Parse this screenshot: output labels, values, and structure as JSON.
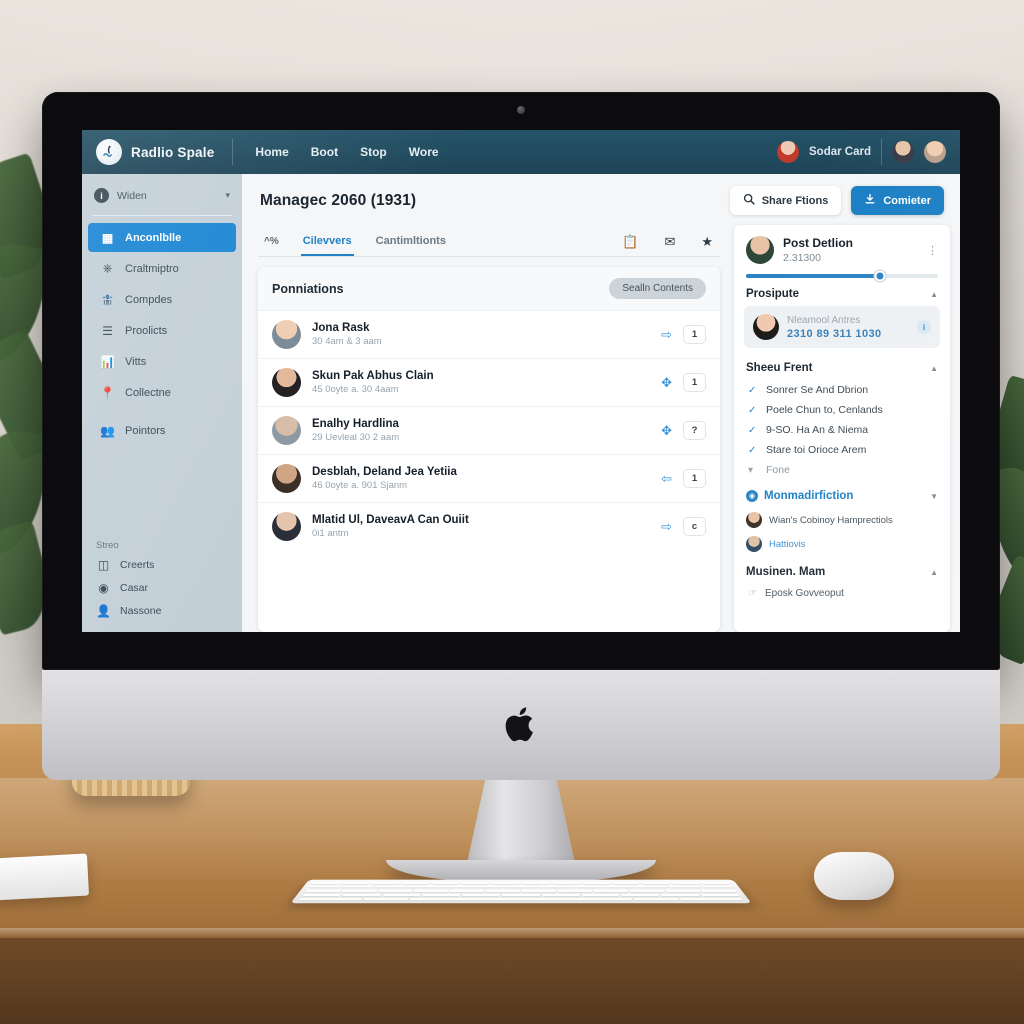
{
  "topnav": {
    "brand_name": "Radlio Spale",
    "brand_logo_icon": "wave-logo-icon",
    "links": [
      {
        "label": "Home"
      },
      {
        "label": "Boot"
      },
      {
        "label": "Stop"
      },
      {
        "label": "Wore"
      }
    ],
    "user_label": "Sodar Card",
    "avatars": [
      "avatar-red",
      "avatar-dark",
      "avatar-tan"
    ]
  },
  "sidebar": {
    "widen": {
      "label": "Widen",
      "badge": "i",
      "caret_icon": "chevron-down-icon"
    },
    "items": [
      {
        "label": "Anconlblle",
        "icon": "grid-icon",
        "active": true
      },
      {
        "label": "Craltmiptro",
        "icon": "clock-icon",
        "active": false
      },
      {
        "label": "Compdes",
        "icon": "bank-icon",
        "active": false
      },
      {
        "label": "Proolicts",
        "icon": "list-icon",
        "active": false
      },
      {
        "label": "Vitts",
        "icon": "chart-icon",
        "active": false
      },
      {
        "label": "Collectne",
        "icon": "pin-icon",
        "active": false
      },
      {
        "label": "Pointors",
        "icon": "people-icon",
        "active": false
      }
    ],
    "footer_title": "Streo",
    "footer_items": [
      {
        "label": "Creerts",
        "icon": "door-icon"
      },
      {
        "label": "Casar",
        "icon": "camera-icon"
      },
      {
        "label": "Nassone",
        "icon": "person-icon"
      }
    ]
  },
  "main": {
    "page_title": "Managec 2060 (1931)",
    "share_button": {
      "label": "Share Ftions",
      "icon": "search-icon"
    },
    "primary_button": {
      "label": "Comieter",
      "icon": "download-icon"
    },
    "tabs": [
      {
        "label": "^%",
        "active": false,
        "mini": true
      },
      {
        "label": "Cilevvers",
        "active": true,
        "mini": false
      },
      {
        "label": "Cantimltionts",
        "active": false,
        "mini": false
      }
    ],
    "tab_icons": [
      "note-edit-icon",
      "mail-icon",
      "star-icon"
    ],
    "card": {
      "title": "Ponniations",
      "pill_label": "Sealln Contents",
      "rows": [
        {
          "name": "Jona Rask",
          "sub": "30 4am & 3 aam",
          "arrow_icon": "arrow-right-icon",
          "badge": "1"
        },
        {
          "name": "Skun Pak Abhus Clain",
          "sub": "45 0oyte a. 30 4aam",
          "arrow_icon": "arrows-move-icon",
          "badge": "1"
        },
        {
          "name": "Enalhy Hardlina",
          "sub": "29 Uevleal 30 2 aam",
          "arrow_icon": "arrows-move-icon",
          "badge": "?"
        },
        {
          "name": "Desblah, Deland Jea Yetiia",
          "sub": "46 0oyte a. 901 Sjanm",
          "arrow_icon": "arrow-left-icon",
          "badge": "1"
        },
        {
          "name": "Mlatid Ul, DaveavA Can Ouiit",
          "sub": "0i1 antm",
          "arrow_icon": "arrow-right-icon",
          "badge": "c"
        }
      ]
    }
  },
  "right_panel": {
    "header": {
      "title": "Post Detlion",
      "number": "2.31300",
      "menu_icon": "more-icon"
    },
    "slider": {
      "value_percent": 70
    },
    "section_prosipute": {
      "title": "Prosipute",
      "caret_icon": "chevron-up-icon"
    },
    "chip": {
      "name": "Nleamool Antres",
      "number": "2310 89 311 1030",
      "icon": "info-icon"
    },
    "section_sheeu": {
      "title": "Sheeu Frent",
      "caret_icon": "chevron-up-icon"
    },
    "checks": [
      {
        "label": "Sonrer Se And Dbrion",
        "checked": true
      },
      {
        "label": "Poele Chun to, Cenlands",
        "checked": true
      },
      {
        "label": "9-SO. Ha An & Niema",
        "checked": true
      },
      {
        "label": "Stare toi Orioce Arem",
        "checked": true
      },
      {
        "label": "Fone",
        "checked": false
      }
    ],
    "section_monm": {
      "title": "Monmadirfiction",
      "caret_icon": "chevron-down-icon",
      "icon": "globe-icon"
    },
    "links": [
      {
        "label": "Wian's Cobinoy Hamprectiols",
        "is_link": false
      },
      {
        "label": "Hattiovis",
        "is_link": true
      }
    ],
    "section_musinen": {
      "title": "Musinen. Mam",
      "caret_icon": "chevron-up-icon"
    },
    "footer": {
      "label": "Eposk Govveoput",
      "icon": "bookmark-icon"
    }
  },
  "colors": {
    "nav_bg": "#1e4557",
    "accent": "#1c7fc4",
    "sidebar_bg": "#c4d0d8",
    "canvas_bg": "#f4f6f8"
  }
}
